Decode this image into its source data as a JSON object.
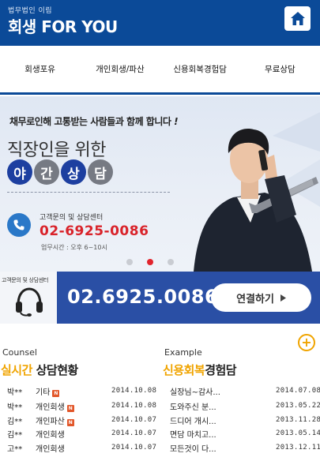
{
  "header": {
    "brand_sub": "법무법인 이림",
    "brand_main": "회생 FOR YOU"
  },
  "nav": {
    "items": [
      "회생포유",
      "개인회생/파산",
      "신용회복경험담",
      "무료상담"
    ]
  },
  "banner": {
    "top_text": "채무로인해 고통받는 사람들과 함께 합니다",
    "top_bang": "!",
    "headline": "직장인을 위한",
    "circles": [
      "야",
      "간",
      "상",
      "담"
    ],
    "cs_label": "고객문의 및 상담센터",
    "cs_phone": "02-6925-0086",
    "cs_hours": "업무시간 : 오후 6~10시"
  },
  "callbar": {
    "label": "고객문의 및 상담센터",
    "number": "02.6925.0086",
    "button": "연결하기"
  },
  "counsel": {
    "en": "Counsel",
    "ko_highlight": "실시간",
    "ko_rest": " 상담현황",
    "rows": [
      {
        "name": "박**",
        "type": "기타",
        "new": true,
        "date": "2014.10.08"
      },
      {
        "name": "박**",
        "type": "개인회생",
        "new": true,
        "date": "2014.10.08"
      },
      {
        "name": "김**",
        "type": "개인파산",
        "new": true,
        "date": "2014.10.07"
      },
      {
        "name": "김**",
        "type": "개인회생",
        "new": false,
        "date": "2014.10.07"
      },
      {
        "name": "고**",
        "type": "개인회생",
        "new": false,
        "date": "2014.10.07"
      }
    ]
  },
  "example": {
    "en": "Example",
    "ko_highlight": "신용회복",
    "ko_rest": "경험담",
    "more": "+",
    "rows": [
      {
        "title": "실장님~감사...",
        "date": "2014.07.08"
      },
      {
        "title": "도와주신 분...",
        "date": "2013.05.22"
      },
      {
        "title": "드디어 개시...",
        "date": "2013.11.28"
      },
      {
        "title": "면담 마치고...",
        "date": "2013.05.14"
      },
      {
        "title": "모든것이 다...",
        "date": "2013.12.11"
      }
    ]
  },
  "slider": {
    "count": 3,
    "active": 2
  },
  "colors": {
    "brand": "#0b4a98",
    "accent": "#f0a400",
    "red": "#d9232a",
    "callbar": "#2a4fa5"
  }
}
